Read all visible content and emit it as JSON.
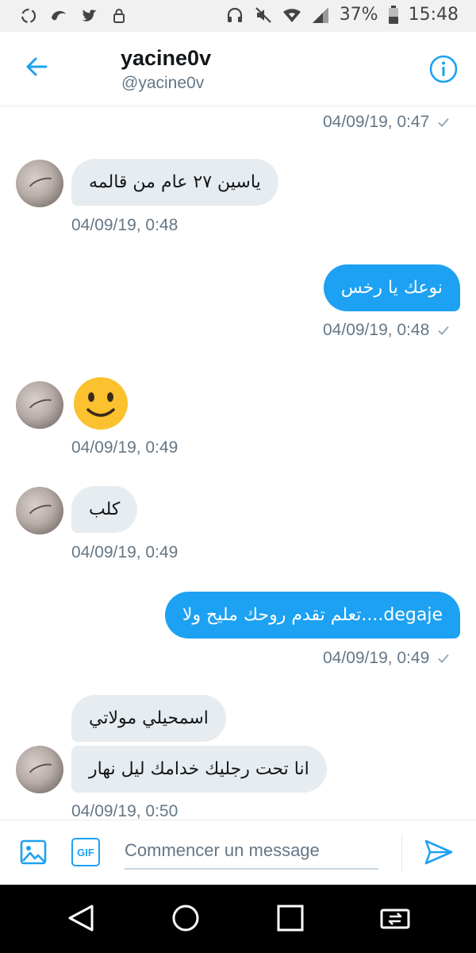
{
  "status_bar": {
    "battery": "37%",
    "time": "15:48",
    "left_icons": [
      "recycle-icon",
      "app-icon",
      "twitter-icon",
      "lock-icon"
    ],
    "right_icons": [
      "headphones-icon",
      "mute-icon",
      "wifi-icon",
      "signal-icon",
      "battery-icon"
    ]
  },
  "header": {
    "name": "yacine0v",
    "handle": "@yacine0v"
  },
  "messages": [
    {
      "type": "timestamp",
      "side": "out",
      "text": "04/09/19, 0:47"
    },
    {
      "type": "bubble",
      "side": "in",
      "text": "ياسين ٢٧ عام من قالمه"
    },
    {
      "type": "timestamp",
      "side": "in",
      "text": "04/09/19, 0:48"
    },
    {
      "type": "bubble",
      "side": "out",
      "text": "نوعك يا رخس"
    },
    {
      "type": "timestamp",
      "side": "out",
      "text": "04/09/19, 0:48"
    },
    {
      "type": "emoji",
      "side": "in",
      "emoji": "smiling-face"
    },
    {
      "type": "timestamp",
      "side": "in",
      "text": "04/09/19, 0:49"
    },
    {
      "type": "bubble",
      "side": "in",
      "text": "كلب"
    },
    {
      "type": "timestamp",
      "side": "in",
      "text": "04/09/19, 0:49"
    },
    {
      "type": "bubble",
      "side": "out",
      "text": "تعلم تقدم روحك مليح ولا....degaje"
    },
    {
      "type": "timestamp",
      "side": "out",
      "text": "04/09/19, 0:49"
    },
    {
      "type": "bubble",
      "side": "in",
      "text": "اسمحيلي مولاتي"
    },
    {
      "type": "bubble",
      "side": "in",
      "text": "انا تحت رجليك خدامك ليل نهار"
    },
    {
      "type": "timestamp",
      "side": "in",
      "text": "04/09/19, 0:50"
    }
  ],
  "composer": {
    "gif_label": "GIF",
    "placeholder": "Commencer un message"
  },
  "colors": {
    "accent": "#1da1f2",
    "incoming_bubble": "#e6ecf0",
    "timestamp": "#657786"
  }
}
